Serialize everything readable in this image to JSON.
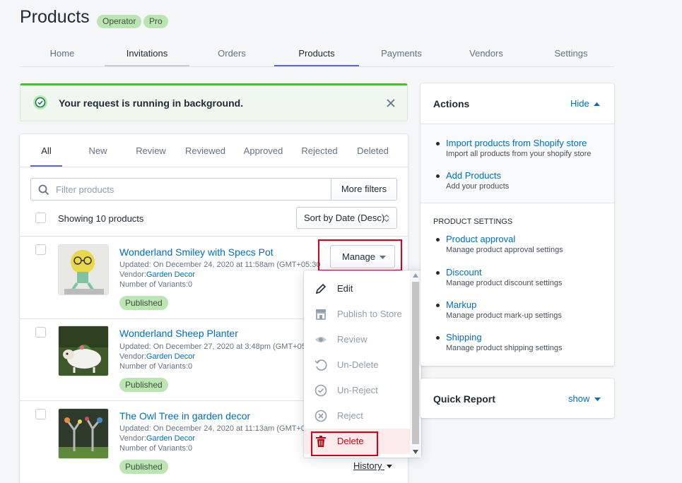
{
  "page": {
    "title": "Products",
    "badges": [
      "Operator",
      "Pro"
    ]
  },
  "nav": {
    "items": [
      "Home",
      "Invitations",
      "Orders",
      "Products",
      "Payments",
      "Vendors",
      "Settings"
    ],
    "active": "Products"
  },
  "banner": {
    "message": "Your request is running in background."
  },
  "product_tabs": [
    "All",
    "New",
    "Review",
    "Reviewed",
    "Approved",
    "Rejected",
    "Deleted"
  ],
  "filter": {
    "placeholder": "Filter products",
    "more_filters_label": "More filters",
    "showing_label": "Showing 10 products",
    "sort_label": "Sort by Date (Desc)"
  },
  "products": [
    {
      "title": "Wonderland Smiley with Specs Pot",
      "updated": "Updated: On December 24, 2020 at 11:58am (GMT+05:30",
      "vendor_prefix": "Vendor:",
      "vendor": "Garden Decor",
      "variants": "Number of Variants:0",
      "status": "Published"
    },
    {
      "title": "Wonderland Sheep Planter",
      "updated": "Updated: On December 27, 2020 at 3:48pm (GMT+05:3",
      "vendor_prefix": "Vendor:",
      "vendor": "Garden Decor",
      "variants": "Number of Variants:0",
      "status": "Published"
    },
    {
      "title": "The Owl Tree in garden decor",
      "updated": "Updated: On December 24, 2020 at 11:13am (GMT+05:",
      "vendor_prefix": "Vendor:",
      "vendor": "Garden Decor",
      "variants": "Number of Variants:0",
      "status": "Published"
    }
  ],
  "manage": {
    "button_label": "Manage",
    "history_label": "History",
    "menu": [
      {
        "label": "Edit",
        "icon": "pencil-icon",
        "enabled": true
      },
      {
        "label": "Publish to Store",
        "icon": "store-icon",
        "enabled": false
      },
      {
        "label": "Review",
        "icon": "eye-icon",
        "enabled": false
      },
      {
        "label": "Un-Delete",
        "icon": "undo-icon",
        "enabled": false
      },
      {
        "label": "Un-Reject",
        "icon": "check-circle-icon",
        "enabled": false
      },
      {
        "label": "Reject",
        "icon": "x-circle-icon",
        "enabled": false
      },
      {
        "label": "Delete",
        "icon": "trash-icon",
        "enabled": true
      }
    ]
  },
  "actions_panel": {
    "title": "Actions",
    "toggle_label": "Hide",
    "links": [
      {
        "title": "Import products from Shopify store",
        "sub": "Import all products from your shopify store"
      },
      {
        "title": "Add Products",
        "sub": "Add your products"
      }
    ],
    "settings_heading": "PRODUCT SETTINGS",
    "settings": [
      {
        "title": "Product approval",
        "sub": "Manage product approval settings"
      },
      {
        "title": "Discount",
        "sub": "Manage product discount settings"
      },
      {
        "title": "Markup",
        "sub": "Manage product mark-up settings"
      },
      {
        "title": "Shipping",
        "sub": "Manage product shipping settings"
      }
    ]
  },
  "quick_report": {
    "title": "Quick Report",
    "toggle_label": "show"
  },
  "colors": {
    "accent": "#5c6ac4",
    "link": "#006fbb",
    "success": "#50b83c",
    "badge_bg": "#bbe5b3",
    "danger": "#d0021b"
  }
}
